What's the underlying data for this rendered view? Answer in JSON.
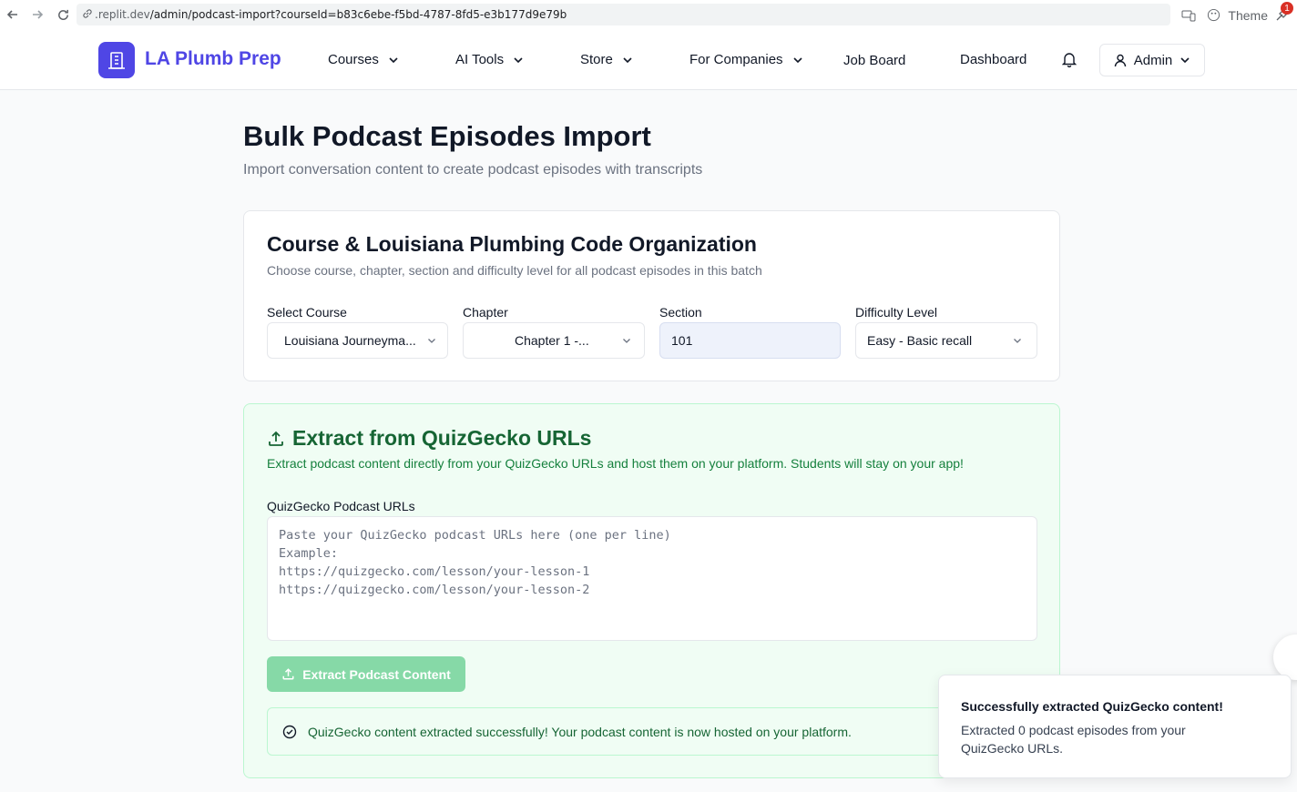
{
  "browser": {
    "url_dim": ".replit.dev",
    "url_path": "/admin/podcast-import?courseId=b83c6ebe-f5bd-4787-8fd5-e3b177d9e79b",
    "theme_label": "Theme",
    "notification_count": "1"
  },
  "header": {
    "brand": "LA Plumb Prep",
    "nav": [
      "Courses",
      "AI Tools",
      "Store",
      "For Companies",
      "Job Board",
      "Dashboard"
    ],
    "admin_label": "Admin"
  },
  "page": {
    "title": "Bulk Podcast Episodes Import",
    "subtitle": "Import conversation content to create podcast episodes with transcripts"
  },
  "org_card": {
    "title": "Course & Louisiana Plumbing Code Organization",
    "description": "Choose course, chapter, section and difficulty level for all podcast episodes in this batch",
    "course_label": "Select Course",
    "course_value": "Louisiana Journeyma...",
    "chapter_label": "Chapter",
    "chapter_value": "Chapter 1 -...",
    "section_label": "Section",
    "section_value": "101",
    "difficulty_label": "Difficulty Level",
    "difficulty_value": "Easy - Basic recall"
  },
  "extract_card": {
    "title": "Extract from QuizGecko URLs",
    "description": "Extract podcast content directly from your QuizGecko URLs and host them on your platform. Students will stay on your app!",
    "urls_label": "QuizGecko Podcast URLs",
    "urls_placeholder": "Paste your QuizGecko podcast URLs here (one per line)\nExample:\nhttps://quizgecko.com/lesson/your-lesson-1\nhttps://quizgecko.com/lesson/your-lesson-2",
    "button_label": "Extract Podcast Content",
    "success_message": "QuizGecko content extracted successfully! Your podcast content is now hosted on your platform."
  },
  "toast": {
    "title": "Successfully extracted QuizGecko content!",
    "body": "Extracted 0 podcast episodes from your QuizGecko URLs."
  },
  "colors": {
    "brand": "#4f46e5",
    "success_text": "#166534",
    "success_bg": "#f0fdf4",
    "button_green": "#86d9a7"
  }
}
